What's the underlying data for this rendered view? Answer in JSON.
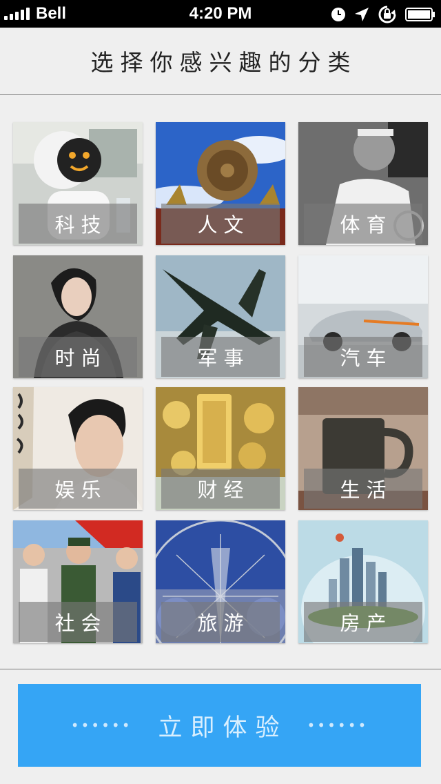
{
  "status_bar": {
    "carrier": "Bell",
    "time": "4:20 PM",
    "icons": [
      "signal-icon",
      "alarm-icon",
      "location-icon",
      "rotation-lock-icon",
      "battery-icon"
    ]
  },
  "header": {
    "title": "选择你感兴趣的分类"
  },
  "categories": [
    {
      "label": "科技",
      "icon": "tech-robot-image"
    },
    {
      "label": "人文",
      "icon": "culture-wheel-image"
    },
    {
      "label": "体育",
      "icon": "sports-tennis-image"
    },
    {
      "label": "时尚",
      "icon": "fashion-portrait-image"
    },
    {
      "label": "军事",
      "icon": "military-jet-image"
    },
    {
      "label": "汽车",
      "icon": "car-image"
    },
    {
      "label": "娱乐",
      "icon": "entertainment-portrait-image"
    },
    {
      "label": "财经",
      "icon": "finance-gold-image"
    },
    {
      "label": "生活",
      "icon": "life-mug-image"
    },
    {
      "label": "社会",
      "icon": "society-guards-image"
    },
    {
      "label": "旅游",
      "icon": "travel-ferris-wheel-image"
    },
    {
      "label": "房产",
      "icon": "realestate-city-image"
    }
  ],
  "cta": {
    "dots_left": "••••••",
    "label": "立即体验",
    "dots_right": "••••••"
  },
  "colors": {
    "background": "#efefef",
    "status_bar": "#000000",
    "accent": "#35a5f5",
    "label_overlay": "rgba(120,120,120,0.62)"
  }
}
